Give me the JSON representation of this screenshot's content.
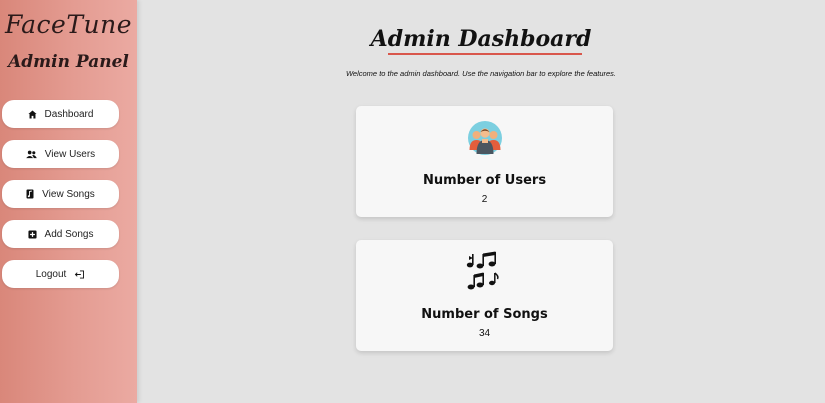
{
  "sidebar": {
    "brand_title": "FaceTune",
    "brand_subtitle": "Admin Panel",
    "items": [
      {
        "label": "Dashboard",
        "icon": "home-icon"
      },
      {
        "label": "View Users",
        "icon": "users-icon"
      },
      {
        "label": "View Songs",
        "icon": "music-file-icon"
      },
      {
        "label": "Add Songs",
        "icon": "plus-square-icon"
      },
      {
        "label": "Logout",
        "icon": "logout-icon"
      }
    ]
  },
  "main": {
    "title": "Admin Dashboard",
    "welcome": "Welcome to the admin dashboard. Use the navigation bar to explore the features.",
    "cards": [
      {
        "title": "Number of Users",
        "value": "2",
        "icon": "users-group-icon"
      },
      {
        "title": "Number of Songs",
        "value": "34",
        "icon": "music-notes-icon"
      }
    ]
  },
  "colors": {
    "sidebar_gradient_start": "#d9877a",
    "sidebar_gradient_end": "#ebaaa2",
    "title_underline": "#d9574c",
    "background": "#e3e3e3",
    "card_background": "#f7f7f7"
  }
}
